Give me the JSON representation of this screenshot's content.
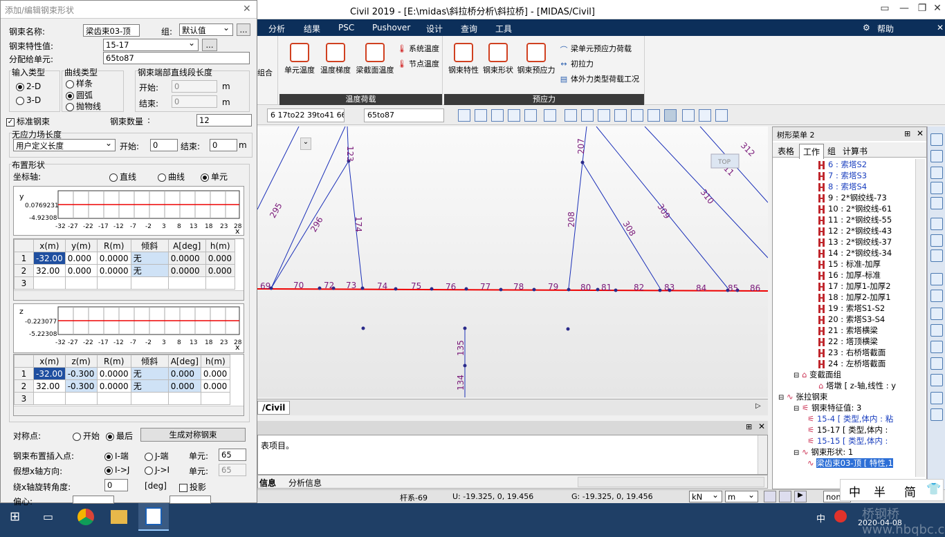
{
  "app": {
    "title": "Civil 2019 - [E:\\midas\\斜拉桥分析\\斜拉桥] - [MIDAS/Civil]",
    "help": "帮助"
  },
  "menu": [
    "分析",
    "结果",
    "PSC",
    "Pushover",
    "设计",
    "查询",
    "工具"
  ],
  "ribbon": {
    "temp_group": "温度荷载",
    "prestress_group": "预应力",
    "btns": {
      "elem_temp": "单元温度",
      "temp_grad": "温度梯度",
      "beam_sec_temp": "梁截面温度",
      "sys_temp": "系统温度",
      "node_temp": "节点温度",
      "tendon_prop": "钢束特性",
      "tendon_shape": "钢束形状",
      "tendon_prestress": "钢束预应力",
      "beam_prestress": "梁单元预应力荷载",
      "pretension": "初拉力",
      "ext_force": "体外力类型荷载工况",
      "left_partial": "组合"
    }
  },
  "toolbar": {
    "sel1": "6 17to22 39to41 66",
    "sel2": "65to87"
  },
  "canvas": {
    "labels": [
      "123",
      "207",
      "295",
      "296",
      "174",
      "208",
      "309",
      "310",
      "311",
      "312",
      "308",
      "69",
      "70",
      "72",
      "73",
      "74",
      "75",
      "76",
      "77",
      "78",
      "79",
      "80",
      "81",
      "82",
      "83",
      "84",
      "85",
      "86",
      "135",
      "134"
    ],
    "view_top": "TOP",
    "tab": "/Civil"
  },
  "tree": {
    "title": "树形菜单 2",
    "tabs": [
      "表格",
      "工作",
      "组",
      "计算书"
    ],
    "items": [
      "6 : 索塔S2",
      "7 : 索塔S3",
      "8 : 索塔S4",
      "9 : 2*钢绞线-73",
      "10 : 2*钢绞线-61",
      "11 : 2*钢绞线-55",
      "12 : 2*钢绞线-43",
      "13 : 2*钢绞线-37",
      "14 : 2*钢绞线-34",
      "15 : 标准-加厚",
      "16 : 加厚-标准",
      "17 : 加厚1-加厚2",
      "18 : 加厚2-加厚1",
      "19 : 索塔S1-S2",
      "20 : 索塔S3-S4",
      "21 : 索塔横梁",
      "22 : 塔顶横梁",
      "23 : 右桥塔截面",
      "24 : 左桥塔截面"
    ],
    "var_section": "变截面组",
    "var_item": "塔墩 [ z-轴,线性 : y",
    "tendon": "张拉钢束",
    "tendon_prop": "钢束特征值: 3",
    "props": [
      "15-4 [ 类型,体内 : 粘",
      "15-17 [ 类型,体内 :",
      "15-15 [ 类型,体内 :"
    ],
    "tendon_shape": "钢束形状: 1",
    "shape_item": "梁齿束03-顶 [ 特性,1"
  },
  "msg": {
    "text": "表项目。",
    "tabs": [
      "信息",
      "分析信息"
    ]
  },
  "status": {
    "elem": "杆系-69",
    "u": "U: -19.325, 0, 19.456",
    "g": "G: -19.325, 0, 19.456",
    "unit_force": "kN",
    "unit_len": "m",
    "none": "none"
  },
  "ime": {
    "a": "中",
    "b": "半",
    "c": "简"
  },
  "taskbar": {
    "clock": "2020-04-08",
    "cn": "中",
    "watermark": "桥钢桥 www.hbqbc.com.cn"
  },
  "dialog": {
    "title": "添加/编辑钢束形状",
    "name_lbl": "钢束名称:",
    "name": "梁齿束03-顶",
    "group_lbl": "组:",
    "group": "默认值",
    "more": "...",
    "prop_lbl": "钢束特性值:",
    "prop": "15-17",
    "assign_lbl": "分配给单元:",
    "assign": "65to87",
    "input_type": "输入类型",
    "it2d": "2-D",
    "it3d": "3-D",
    "curve_type": "曲线类型",
    "spline": "样条",
    "arc": "圆弧",
    "parabola": "抛物线",
    "end_len": "钢束端部直线段长度",
    "start": "开始:",
    "end": "结束:",
    "start_v": "0",
    "end_v": "0",
    "m": "m",
    "std_tendon": "标准钢束",
    "count_lbl": "钢束数量",
    "count": "12",
    "free_len": "无应力场长度",
    "user_def": "用户定义长度",
    "fs": "开始:",
    "fe": "结束:",
    "fs_v": "0",
    "fe_v": "0",
    "layout": "布置形状",
    "axis": "坐标轴:",
    "line": "直线",
    "curve": "曲线",
    "elem": "单元",
    "y_plot": {
      "axis": "y",
      "ymax": "0.0769231",
      "ymin": "-4.92308",
      "ticks": [
        "-32",
        "-27",
        "-22",
        "-17",
        "-12",
        "-7",
        "-2",
        "3",
        "8",
        "13",
        "18",
        "23",
        "28"
      ],
      "x": "x"
    },
    "z_plot": {
      "axis": "z",
      "ymax": "-0.223077",
      "ymin": "-5.22308",
      "ticks": [
        "-32",
        "-27",
        "-22",
        "-17",
        "-12",
        "-7",
        "-2",
        "3",
        "8",
        "13",
        "18",
        "23",
        "28"
      ],
      "x": "x"
    },
    "ytable": {
      "cols": [
        "x(m)",
        "y(m)",
        "R(m)",
        "倾斜",
        "A[deg]",
        "h(m)"
      ],
      "rows": [
        [
          "1",
          "-32.00",
          "0.000",
          "0.0000",
          "无",
          "0.0000",
          "0.000"
        ],
        [
          "2",
          "32.00",
          "0.000",
          "0.0000",
          "无",
          "0.0000",
          "0.000"
        ],
        [
          "3",
          "",
          "",
          "",
          "",
          "",
          ""
        ]
      ]
    },
    "ztable": {
      "cols": [
        "x(m)",
        "z(m)",
        "R(m)",
        "倾斜",
        "A[deg]",
        "h(m)"
      ],
      "rows": [
        [
          "1",
          "-32.00",
          "-0.300",
          "0.0000",
          "无",
          "0.000",
          "0.000"
        ],
        [
          "2",
          "32.00",
          "-0.300",
          "0.0000",
          "无",
          "0.000",
          "0.000"
        ],
        [
          "3",
          "",
          "",
          "",
          "",
          "",
          ""
        ]
      ]
    },
    "sym": "对称点:",
    "sym_start": "开始",
    "sym_end": "最后",
    "gen_sym": "生成对称钢束",
    "insert": "钢束布置插入点:",
    "iend": "I-端",
    "jend": "J-端",
    "unit1": "单元:",
    "unit1_v": "65",
    "xdir": "假想x轴方向:",
    "ij": "I->J",
    "ji": "J->I",
    "unit2": "单元:",
    "unit2_v": "65",
    "rot": "绕x轴旋转角度:",
    "rot_v": "0",
    "deg": "[deg]",
    "proj": "投影",
    "offset": "偏心:"
  }
}
